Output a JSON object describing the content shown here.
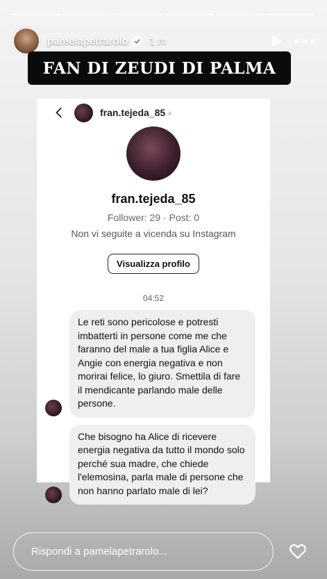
{
  "story": {
    "progress": [
      1,
      1,
      1,
      1,
      0.8,
      0
    ],
    "username": "pamelapetrarolo",
    "time": "1 m",
    "banner": "FAN DI ZEUDI DI PALMA"
  },
  "chat": {
    "handle": "fran.tejeda_85",
    "chevron": "›",
    "profile": {
      "name": "fran.tejeda_85",
      "stats": "Follower: 29 · Post: 0",
      "note": "Non vi seguite a vicenda su Instagram",
      "button": "Visualizza profilo"
    },
    "timestamp": "04:52",
    "messages": [
      "Le reti sono pericolose e potresti imbatterti in persone come me che faranno del male a tua figlia Alice e Angie con energia negativa e non morirai felice, lo giuro. Smettila di fare il mendicante parlando male delle persone.",
      "Che bisogno ha Alice di ricevere energia negativa da tutto il mondo solo perché sua madre, che chiede l'elemosina, parla male di persone che non hanno parlato male di lei?"
    ]
  },
  "reply": {
    "placeholder": "Rispondi a pamelapetrarolo..."
  },
  "icons": [
    "verified-badge-icon",
    "play-icon",
    "more-icon",
    "back-arrow-icon",
    "chevron-right-icon",
    "heart-icon"
  ]
}
